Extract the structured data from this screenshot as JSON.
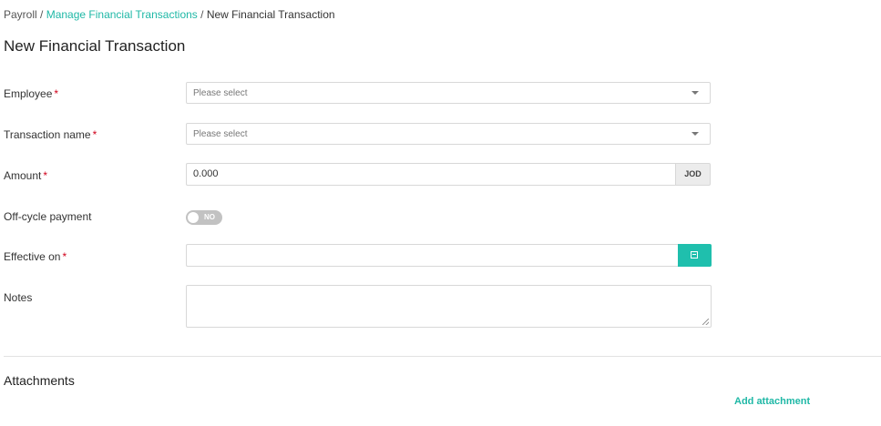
{
  "breadcrumb": {
    "root": "Payroll",
    "parent": "Manage Financial Transactions",
    "current": "New Financial Transaction",
    "separator": " / "
  },
  "page_title": "New Financial Transaction",
  "required_marker": "*",
  "form": {
    "employee": {
      "label": "Employee",
      "placeholder": "Please select"
    },
    "transaction_name": {
      "label": "Transaction name",
      "placeholder": "Please select"
    },
    "amount": {
      "label": "Amount",
      "value": "0.000",
      "currency": "JOD"
    },
    "off_cycle": {
      "label": "Off-cycle payment",
      "toggle_text": "NO"
    },
    "effective_on": {
      "label": "Effective on",
      "value": ""
    },
    "notes": {
      "label": "Notes",
      "value": ""
    }
  },
  "attachments": {
    "title": "Attachments",
    "add_label": "Add attachment"
  },
  "colors": {
    "accent": "#1fbfad",
    "required": "#d0021b"
  },
  "icons": {
    "dropdown": "caret-down-icon",
    "calendar": "calendar-icon"
  }
}
